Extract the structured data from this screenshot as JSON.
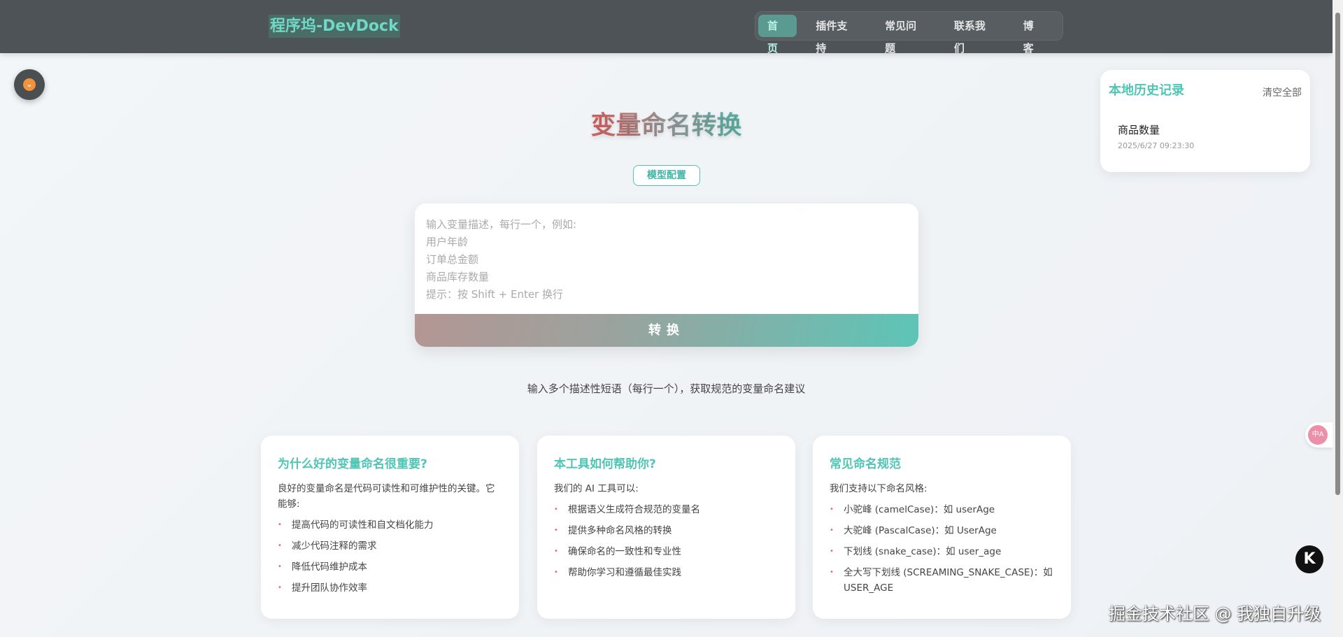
{
  "header": {
    "logo": "程序坞-DevDock",
    "nav": [
      "首页",
      "插件支持",
      "常见问题",
      "联系我们",
      "博客"
    ]
  },
  "history": {
    "title": "本地历史记录",
    "clear": "清空全部",
    "items": [
      {
        "title": "商品数量",
        "date": "2025/6/27 09:23:30"
      }
    ]
  },
  "main": {
    "title": "变量命名转换",
    "config_button": "模型配置",
    "placeholder_lines": [
      "输入变量描述，每行一个，例如:",
      "用户年龄",
      "订单总金额",
      "商品库存数量",
      "提示：按 Shift + Enter 换行"
    ],
    "convert_button": "转换",
    "subtitle": "输入多个描述性短语（每行一个），获取规范的变量命名建议"
  },
  "cards": [
    {
      "title": "为什么好的变量命名很重要?",
      "intro": "良好的变量命名是代码可读性和可维护性的关键。它能够:",
      "items": [
        "提高代码的可读性和自文档化能力",
        "减少代码注释的需求",
        "降低代码维护成本",
        "提升团队协作效率"
      ]
    },
    {
      "title": "本工具如何帮助你?",
      "intro": "我们的 AI 工具可以:",
      "items": [
        "根据语义生成符合规范的变量名",
        "提供多种命名风格的转换",
        "确保命名的一致性和专业性",
        "帮助你学习和遵循最佳实践"
      ]
    },
    {
      "title": "常见命名规范",
      "intro": "我们支持以下命名风格:",
      "items": [
        "小驼峰 (camelCase)：如 userAge",
        "大驼峰 (PascalCase)：如 UserAge",
        "下划线 (snake_case)：如 user_age",
        "全大写下划线 (SCREAMING_SNAKE_CASE)：如 USER_AGE"
      ]
    }
  ],
  "floating": {
    "translate": "中A",
    "k": "K"
  },
  "watermark": "掘金技术社区 @ 我独自升级"
}
